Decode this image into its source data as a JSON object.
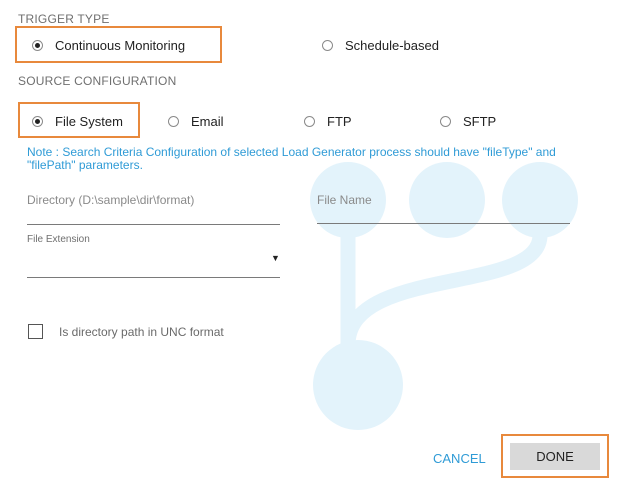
{
  "trigger": {
    "label": "TRIGGER TYPE",
    "options": [
      "Continuous Monitoring",
      "Schedule-based"
    ],
    "selected": "Continuous Monitoring"
  },
  "source": {
    "label": "SOURCE CONFIGURATION",
    "options": [
      "File System",
      "Email",
      "FTP",
      "SFTP"
    ],
    "selected": "File System"
  },
  "note": {
    "line1": "Note : Search Criteria Configuration of selected Load Generator process should have \"fileType\" and",
    "line2": "\"filePath\" parameters."
  },
  "fields": {
    "directory_placeholder": "Directory (D:\\sample\\dir\\format)",
    "filename_placeholder": "File Name",
    "file_extension_label": "File Extension",
    "dropdown_arrow": "▼"
  },
  "unc": {
    "label": "Is directory path in UNC format",
    "checked": false
  },
  "buttons": {
    "cancel": "CANCEL",
    "done": "DONE"
  },
  "colors": {
    "accent": "#2f9bd6",
    "highlight": "#e8893c",
    "watermark": "#e3f3fb"
  },
  "icons": {
    "watermark": "fork-watermark-icon"
  }
}
